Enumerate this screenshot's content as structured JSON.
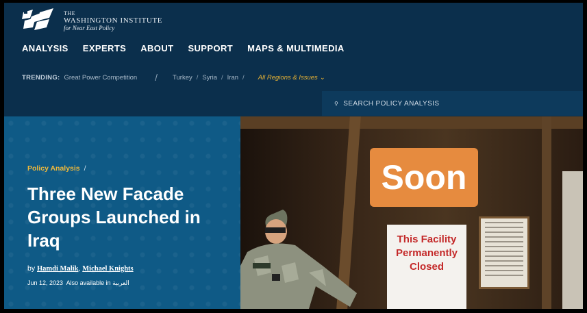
{
  "org": {
    "line1": "THE",
    "line2": "WASHINGTON INSTITUTE",
    "line3": "for Near East Policy"
  },
  "nav": [
    "ANALYSIS",
    "EXPERTS",
    "ABOUT",
    "SUPPORT",
    "MAPS & MULTIMEDIA"
  ],
  "trending": {
    "label": "TRENDING:",
    "primary": "Great Power Competition",
    "topics": [
      "Turkey",
      "Syria",
      "Iran"
    ],
    "all": "All Regions & Issues ⌄"
  },
  "search": {
    "placeholder": "SEARCH POLICY ANALYSIS"
  },
  "article": {
    "kicker": "Policy Analysis",
    "kicker_sep": "/",
    "title": "Three New Facade Groups Launched in Iraq",
    "by": "by",
    "authors": [
      "Hamdi Malik",
      "Michael Knights"
    ],
    "date": "Jun 12, 2023",
    "also": "Also available in",
    "lang": "العربية"
  },
  "image": {
    "sign_top": "Soon",
    "sign_bottom": "This Facility Permanently Closed"
  },
  "colors": {
    "header_bg": "#0b2f4c",
    "hero_bg": "#0f5a86",
    "accent": "#f0b93b"
  }
}
